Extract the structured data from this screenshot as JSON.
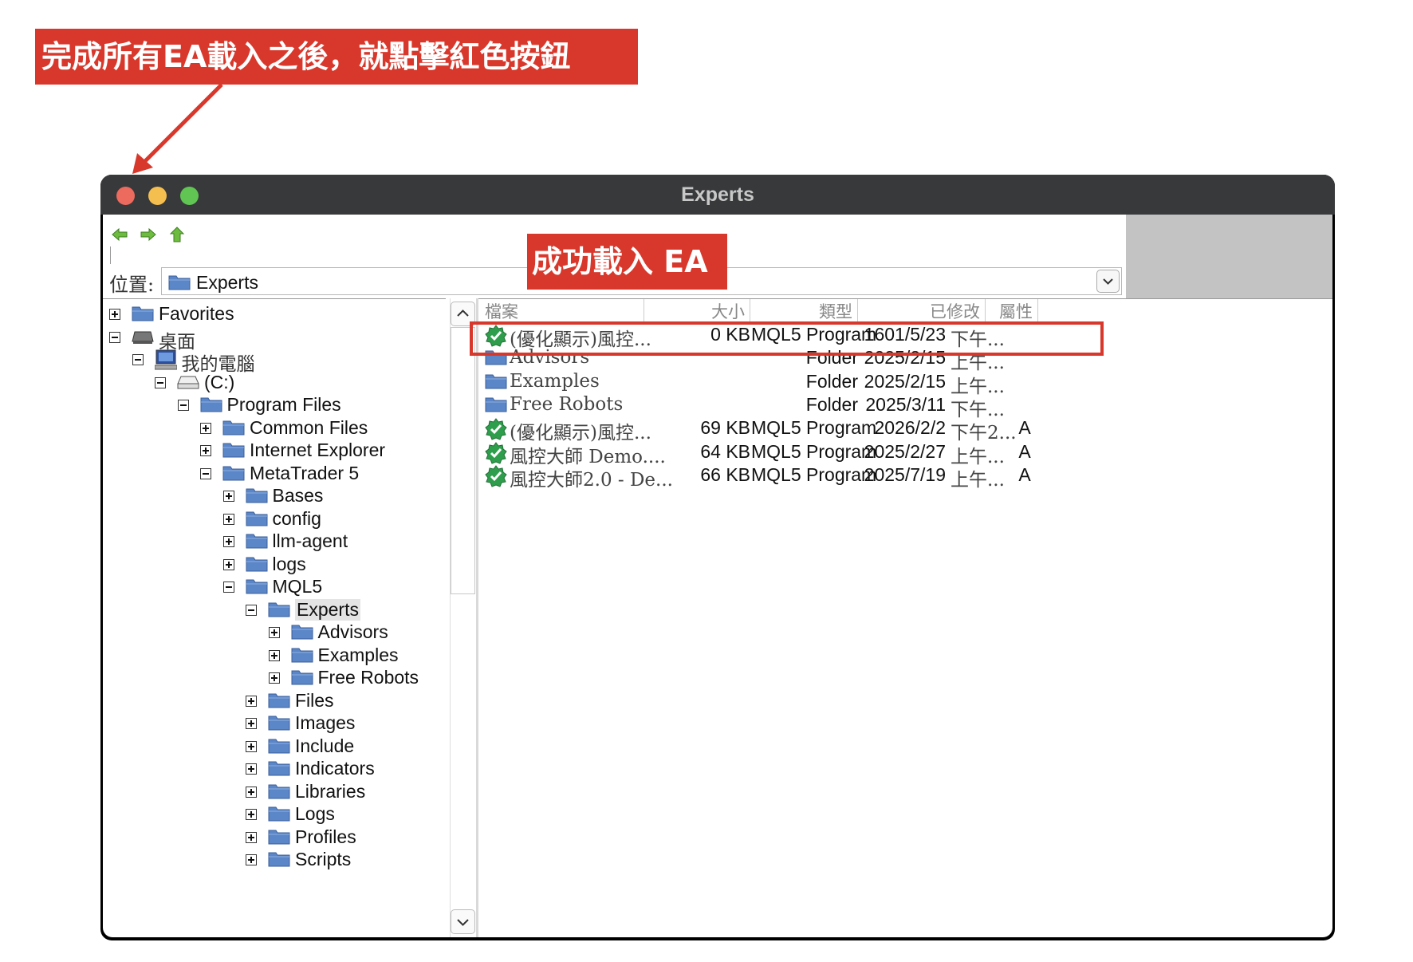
{
  "annotations": {
    "top_note": "完成所有EA載入之後，就點擊紅色按鈕",
    "success_note": "成功載入 EA"
  },
  "colors": {
    "annotation_red": "#d8382c",
    "titlebar": "#38393b",
    "folder_blue": "#5b86c8",
    "ea_green": "#2e9e4c"
  },
  "window": {
    "title": "Experts"
  },
  "toolbar": {
    "back_icon": "back-arrow-icon",
    "forward_icon": "forward-arrow-icon",
    "up_icon": "up-arrow-icon"
  },
  "location": {
    "label": "位置:",
    "value": "Experts"
  },
  "tree": {
    "items": [
      {
        "label": "Favorites",
        "toggle": "plus",
        "icon": "folder-icon"
      },
      {
        "label": "桌面",
        "toggle": "minus",
        "icon": "desktop-icon"
      },
      {
        "label": "我的電腦",
        "toggle": "minus",
        "icon": "computer-icon"
      },
      {
        "label": "(C:)",
        "toggle": "minus",
        "icon": "drive-icon"
      },
      {
        "label": "Program Files",
        "toggle": "minus",
        "icon": "folder-icon"
      },
      {
        "label": "Common Files",
        "toggle": "plus",
        "icon": "folder-icon"
      },
      {
        "label": "Internet Explorer",
        "toggle": "plus",
        "icon": "folder-icon"
      },
      {
        "label": "MetaTrader 5",
        "toggle": "minus",
        "icon": "folder-icon"
      },
      {
        "label": "Bases",
        "toggle": "plus",
        "icon": "folder-icon"
      },
      {
        "label": "config",
        "toggle": "plus",
        "icon": "folder-icon"
      },
      {
        "label": "llm-agent",
        "toggle": "plus",
        "icon": "folder-icon"
      },
      {
        "label": "logs",
        "toggle": "plus",
        "icon": "folder-icon"
      },
      {
        "label": "MQL5",
        "toggle": "minus",
        "icon": "folder-icon"
      },
      {
        "label": "Experts",
        "toggle": "minus",
        "icon": "folder-icon",
        "selected": true
      },
      {
        "label": "Advisors",
        "toggle": "plus",
        "icon": "folder-icon"
      },
      {
        "label": "Examples",
        "toggle": "plus",
        "icon": "folder-icon"
      },
      {
        "label": "Free Robots",
        "toggle": "plus",
        "icon": "folder-icon"
      },
      {
        "label": "Files",
        "toggle": "plus",
        "icon": "folder-icon"
      },
      {
        "label": "Images",
        "toggle": "plus",
        "icon": "folder-icon"
      },
      {
        "label": "Include",
        "toggle": "plus",
        "icon": "folder-icon"
      },
      {
        "label": "Indicators",
        "toggle": "plus",
        "icon": "folder-icon"
      },
      {
        "label": "Libraries",
        "toggle": "plus",
        "icon": "folder-icon"
      },
      {
        "label": "Logs",
        "toggle": "plus",
        "icon": "folder-icon"
      },
      {
        "label": "Profiles",
        "toggle": "plus",
        "icon": "folder-icon"
      },
      {
        "label": "Scripts",
        "toggle": "plus",
        "icon": "folder-icon"
      }
    ]
  },
  "files": {
    "columns": [
      "檔案",
      "大小",
      "類型",
      "已修改",
      "屬性"
    ],
    "rows": [
      {
        "icon": "ea-program-icon",
        "name": "(優化顯示)風控...",
        "size": "0 KB",
        "type": "MQL5 Program",
        "date": "1601/5/23",
        "time": "下午...",
        "attr": ""
      },
      {
        "icon": "folder-icon",
        "name": "Advisors",
        "size": "",
        "type": "Folder",
        "date": "2025/2/15",
        "time": "上午...",
        "attr": ""
      },
      {
        "icon": "folder-icon",
        "name": "Examples",
        "size": "",
        "type": "Folder",
        "date": "2025/2/15",
        "time": "上午...",
        "attr": ""
      },
      {
        "icon": "folder-icon",
        "name": "Free Robots",
        "size": "",
        "type": "Folder",
        "date": "2025/3/11",
        "time": "下午...",
        "attr": ""
      },
      {
        "icon": "ea-program-icon",
        "name": "(優化顯示)風控...",
        "size": "69 KB",
        "type": "MQL5 Program",
        "date": "2026/2/2",
        "time": "下午2...",
        "attr": "A"
      },
      {
        "icon": "ea-program-icon",
        "name": "風控大師 Demo....",
        "size": "64 KB",
        "type": "MQL5 Program",
        "date": "2025/2/27",
        "time": "上午...",
        "attr": "A"
      },
      {
        "icon": "ea-program-icon",
        "name": "風控大師2.0 - De...",
        "size": "66 KB",
        "type": "MQL5 Program",
        "date": "2025/7/19",
        "time": "上午...",
        "attr": "A"
      }
    ]
  }
}
